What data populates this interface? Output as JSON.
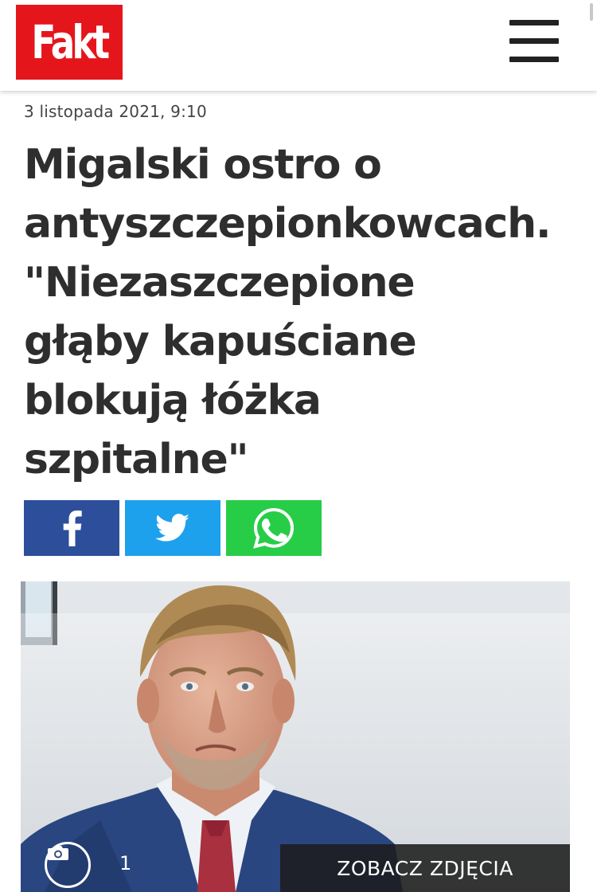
{
  "header": {
    "logo_text": "Fakt",
    "brand_color": "#e4161c",
    "menu_icon": "hamburger-menu-icon"
  },
  "article": {
    "date": "3 listopada 2021, 9:10",
    "title_lines": [
      "Migalski ostro o",
      "antyszczepionkowcach.",
      "\"Niezaszczepione",
      "głąby kapuściane",
      "blokują łóżka",
      "szpitalne\""
    ]
  },
  "share": {
    "buttons": [
      {
        "network": "facebook",
        "icon": "facebook-icon",
        "color": "#2d4e9a"
      },
      {
        "network": "twitter",
        "icon": "twitter-icon",
        "color": "#1ea1ec"
      },
      {
        "network": "whatsapp",
        "icon": "whatsapp-icon",
        "color": "#27cd47"
      }
    ]
  },
  "photo": {
    "camera_icon": "camera-icon",
    "count": "1",
    "gallery_button_label": "ZOBACZ ZDJĘCIA"
  }
}
